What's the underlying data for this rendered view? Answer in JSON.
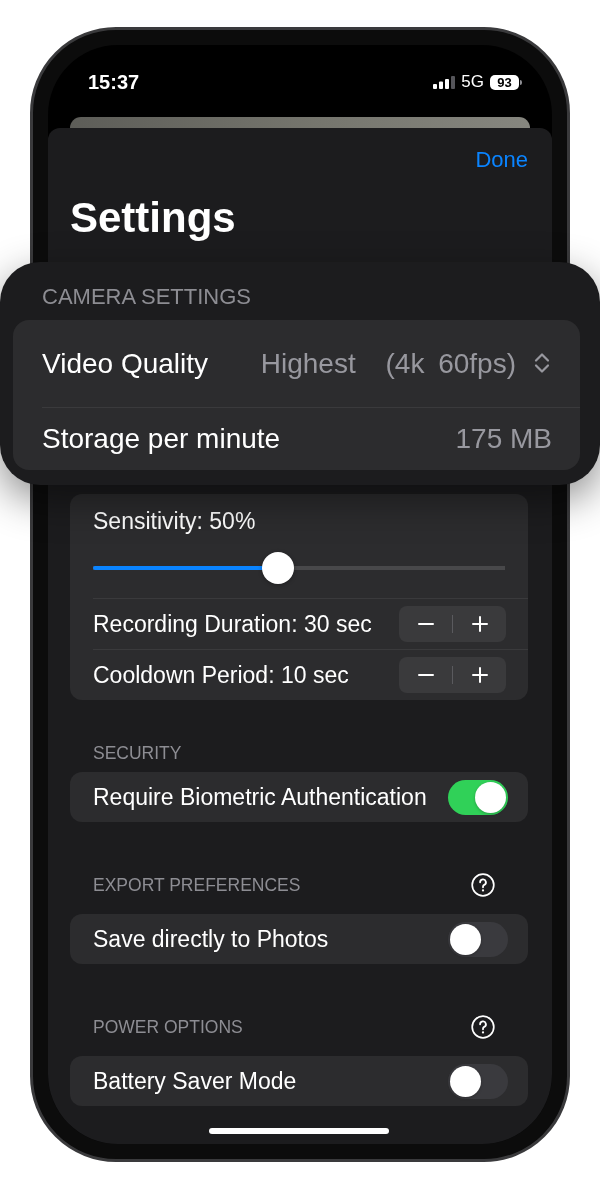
{
  "status_bar": {
    "time": "15:37",
    "network": "5G",
    "battery": "93"
  },
  "sheet": {
    "done": "Done",
    "title": "Settings"
  },
  "callout": {
    "header": "CAMERA SETTINGS",
    "rows": [
      {
        "kind": "picker",
        "label": "Video Quality",
        "value": "Highest",
        "detail": "(4k 60fps)"
      },
      {
        "kind": "value",
        "label": "Storage per minute",
        "value": "175 MB"
      }
    ]
  },
  "groups": [
    {
      "rows": [
        {
          "kind": "slider",
          "label": "Sensitivity: 50%",
          "level": 0.45
        },
        {
          "kind": "stepper",
          "label": "Recording Duration: 30 sec"
        },
        {
          "kind": "stepper",
          "label": "Cooldown Period: 10 sec"
        }
      ]
    },
    {
      "header": "SECURITY",
      "help": false,
      "rows": [
        {
          "kind": "toggle",
          "label": "Require Biometric Authentication",
          "on": true
        }
      ]
    },
    {
      "header": "EXPORT PREFERENCES",
      "help": true,
      "rows": [
        {
          "kind": "toggle",
          "label": "Save directly to Photos",
          "on": false
        }
      ]
    },
    {
      "header": "POWER OPTIONS",
      "help": true,
      "rows": [
        {
          "kind": "toggle",
          "label": "Battery Saver Mode",
          "on": false
        }
      ]
    }
  ]
}
